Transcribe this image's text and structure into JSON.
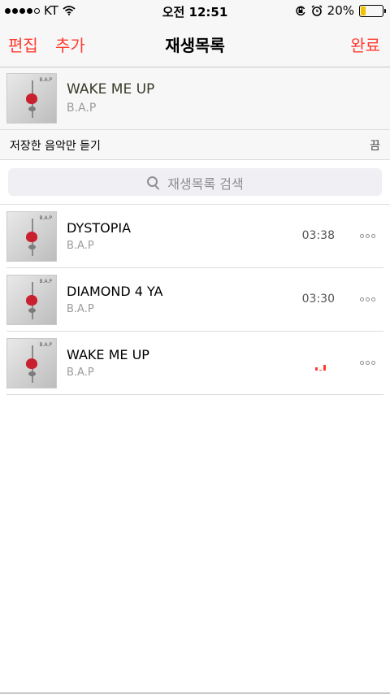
{
  "status_bar": {
    "carrier": "KT",
    "time": "오전 12:51",
    "battery": "20%",
    "signal_icon": "signal-dots-icon",
    "wifi_icon": "wifi-icon",
    "rotation_lock_icon": "rotation-lock-icon",
    "alarm_icon": "alarm-clock-icon",
    "battery_icon": "battery-icon",
    "battery_color": "#f2c200"
  },
  "nav": {
    "edit": "편집",
    "add": "추가",
    "title": "재생목록",
    "done": "완료",
    "accent_color": "#ff3b30"
  },
  "now_playing": {
    "title": "WAKE ME UP",
    "artist": "B.A.P",
    "cover_icon": "album-cover-rose"
  },
  "offline_toggle": {
    "label": "저장한 음악만 듣기",
    "value": "끔"
  },
  "search": {
    "placeholder": "재생목록 검색",
    "icon": "search-icon"
  },
  "songs": [
    {
      "title": "DYSTOPIA",
      "artist": "B.A.P",
      "duration": "03:38"
    },
    {
      "title": "DIAMOND 4 YA",
      "artist": "B.A.P",
      "duration": "03:30"
    },
    {
      "title": "WAKE ME UP",
      "artist": "B.A.P",
      "duration": "",
      "playing_icon": "equalizer-icon"
    }
  ]
}
